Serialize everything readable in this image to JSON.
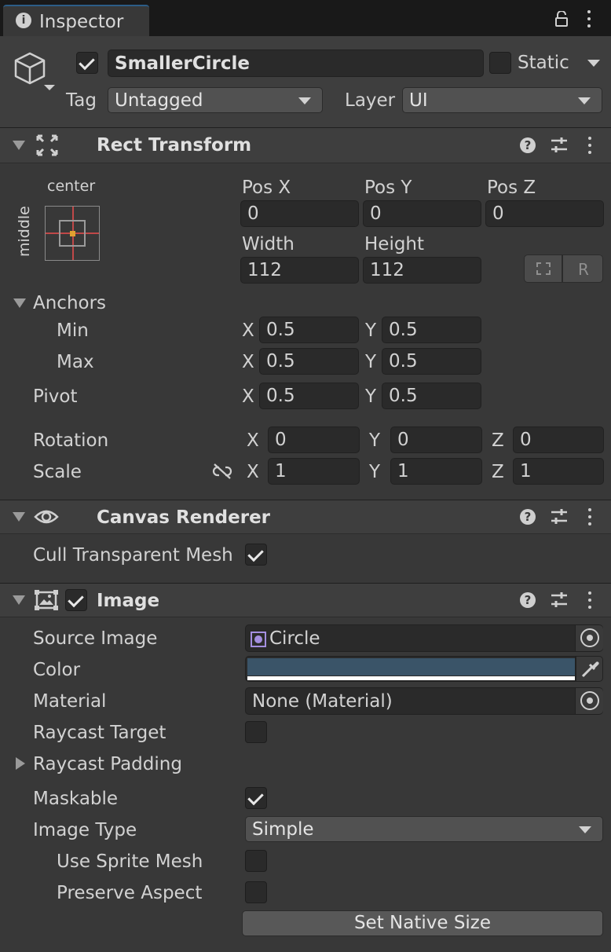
{
  "tab": {
    "title": "Inspector"
  },
  "object": {
    "name": "SmallerCircle",
    "active": true,
    "static_label": "Static",
    "static": false,
    "tag_label": "Tag",
    "tag_value": "Untagged",
    "layer_label": "Layer",
    "layer_value": "UI"
  },
  "rect_transform": {
    "title": "Rect Transform",
    "anchor_preset_h": "center",
    "anchor_preset_v": "middle",
    "pos_x_label": "Pos X",
    "pos_y_label": "Pos Y",
    "pos_z_label": "Pos Z",
    "pos_x": "0",
    "pos_y": "0",
    "pos_z": "0",
    "width_label": "Width",
    "height_label": "Height",
    "width": "112",
    "height": "112",
    "raw_label": "R",
    "anchors_label": "Anchors",
    "min_label": "Min",
    "max_label": "Max",
    "pivot_label": "Pivot",
    "x_label": "X",
    "y_label": "Y",
    "z_label": "Z",
    "min_x": "0.5",
    "min_y": "0.5",
    "max_x": "0.5",
    "max_y": "0.5",
    "pivot_x": "0.5",
    "pivot_y": "0.5",
    "rotation_label": "Rotation",
    "rot_x": "0",
    "rot_y": "0",
    "rot_z": "0",
    "scale_label": "Scale",
    "scale_x": "1",
    "scale_y": "1",
    "scale_z": "1"
  },
  "canvas_renderer": {
    "title": "Canvas Renderer",
    "cull_label": "Cull Transparent Mesh",
    "cull": true
  },
  "image": {
    "title": "Image",
    "enabled": true,
    "source_image_label": "Source Image",
    "source_image": "Circle",
    "color_label": "Color",
    "color": "#3a5468",
    "material_label": "Material",
    "material": "None (Material)",
    "raycast_target_label": "Raycast Target",
    "raycast_target": false,
    "raycast_padding_label": "Raycast Padding",
    "maskable_label": "Maskable",
    "maskable": true,
    "image_type_label": "Image Type",
    "image_type": "Simple",
    "use_sprite_mesh_label": "Use Sprite Mesh",
    "use_sprite_mesh": false,
    "preserve_aspect_label": "Preserve Aspect",
    "preserve_aspect": false,
    "set_native_size_label": "Set Native Size"
  }
}
